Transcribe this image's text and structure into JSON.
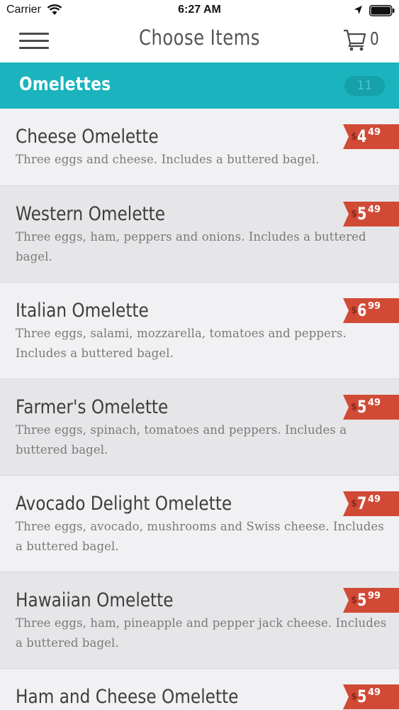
{
  "status": {
    "carrier": "Carrier",
    "time": "6:27 AM"
  },
  "nav": {
    "title": "Choose Items",
    "cart_count": "0"
  },
  "category": {
    "title": "Omelettes",
    "count": "11"
  },
  "colors": {
    "accent": "#1bb3bd",
    "price_tag": "#d14a36"
  },
  "items": [
    {
      "name": "Cheese Omelette",
      "description": "Three eggs and cheese. Includes a buttered bagel.",
      "currency": "$",
      "price_dollars": "4",
      "price_cents": "49"
    },
    {
      "name": "Western Omelette",
      "description": "Three eggs, ham, peppers and onions. Includes a buttered bagel.",
      "currency": "$",
      "price_dollars": "5",
      "price_cents": "49"
    },
    {
      "name": "Italian Omelette",
      "description": "Three eggs, salami, mozzarella, tomatoes and peppers. Includes a buttered bagel.",
      "currency": "$",
      "price_dollars": "6",
      "price_cents": "99"
    },
    {
      "name": "Farmer's Omelette",
      "description": "Three eggs, spinach, tomatoes and peppers. Includes a buttered bagel.",
      "currency": "$",
      "price_dollars": "5",
      "price_cents": "49"
    },
    {
      "name": "Avocado Delight Omelette",
      "description": "Three eggs, avocado, mushrooms and Swiss cheese. Includes a buttered bagel.",
      "currency": "$",
      "price_dollars": "7",
      "price_cents": "49"
    },
    {
      "name": "Hawaiian Omelette",
      "description": "Three eggs, ham, pineapple and pepper jack cheese. Includes a buttered bagel.",
      "currency": "$",
      "price_dollars": "5",
      "price_cents": "99"
    },
    {
      "name": "Ham and Cheese Omelette",
      "description": "",
      "currency": "$",
      "price_dollars": "5",
      "price_cents": "49"
    }
  ]
}
